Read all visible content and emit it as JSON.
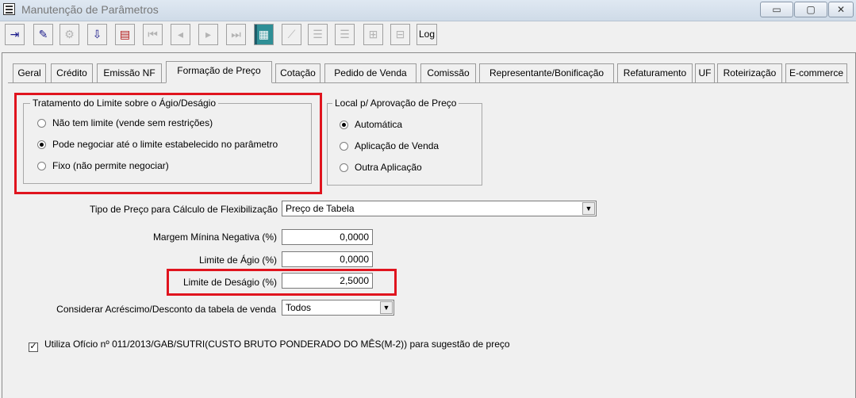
{
  "window": {
    "title": "Manutenção de Parâmetros",
    "minimize": "▭",
    "maximize": "▢",
    "close": "✕"
  },
  "toolbar": {
    "log_label": "Log",
    "icons": [
      "exit-icon",
      "eraser-icon",
      "tools-icon",
      "download-icon",
      "print-icon",
      "first-icon",
      "prev-icon",
      "next-icon",
      "last-icon",
      "grid-icon",
      "disabled-icon-1",
      "disabled-icon-2",
      "disabled-icon-3",
      "disabled-icon-4",
      "disabled-icon-5"
    ]
  },
  "tabs": [
    {
      "label": "Geral"
    },
    {
      "label": "Crédito"
    },
    {
      "label": "Emissão NF"
    },
    {
      "label": "Formação de Preço",
      "active": true
    },
    {
      "label": "Cotação"
    },
    {
      "label": "Pedido de Venda"
    },
    {
      "label": "Comissão"
    },
    {
      "label": "Representante/Bonificação"
    },
    {
      "label": "Refaturamento"
    },
    {
      "label": "UF"
    },
    {
      "label": "Roteirização"
    },
    {
      "label": "E-commerce"
    }
  ],
  "tratamento": {
    "title": "Tratamento do Limite sobre o Ágio/Deságio",
    "options": [
      {
        "label": "Não tem limite (vende sem restrições)",
        "selected": false
      },
      {
        "label": "Pode negociar até o limite estabelecido no parâmetro",
        "selected": true
      },
      {
        "label": "Fixo (não permite negociar)",
        "selected": false
      }
    ]
  },
  "local": {
    "title": "Local p/ Aprovação de Preço",
    "options": [
      {
        "label": "Automática",
        "selected": true
      },
      {
        "label": "Aplicação de Venda",
        "selected": false
      },
      {
        "label": "Outra Aplicação",
        "selected": false
      }
    ]
  },
  "form": {
    "tipo_preco_label": "Tipo de Preço para Cálculo de Flexibilização",
    "tipo_preco_value": "Preço de Tabela",
    "margem_label": "Margem Mínina Negativa (%)",
    "margem_value": "0,0000",
    "agio_label": "Limite de Ágio (%)",
    "agio_value": "0,0000",
    "desagio_label": "Limite de Deságio (%)",
    "desagio_value": "2,5000",
    "considerar_label": "Considerar Acréscimo/Desconto da tabela de venda",
    "considerar_value": "Todos",
    "oficio_label": "Utiliza Ofício nº 011/2013/GAB/SUTRI(CUSTO BRUTO PONDERADO DO MÊS(M-2)) para sugestão de preço",
    "oficio_checked": true
  },
  "colors": {
    "highlight": "#e0141e"
  }
}
